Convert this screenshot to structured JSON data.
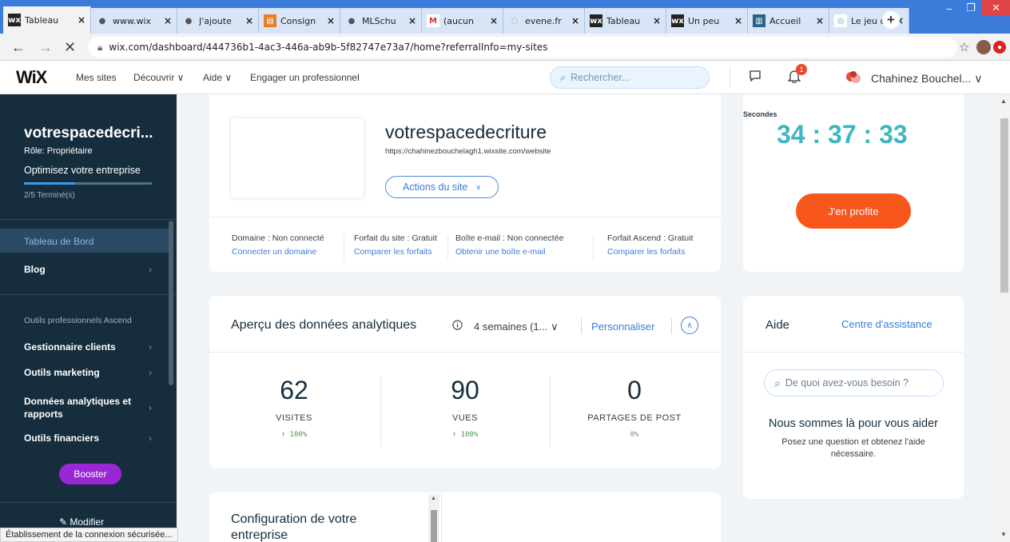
{
  "browser": {
    "tabs": [
      {
        "icon": "wix-icon",
        "title": "Tableau"
      },
      {
        "icon": "globe-icon",
        "title": "www.wix"
      },
      {
        "icon": "globe-icon",
        "title": "J'ajoute"
      },
      {
        "icon": "document-icon",
        "title": "Consign"
      },
      {
        "icon": "globe-icon",
        "title": "MLSchu"
      },
      {
        "icon": "gmail-icon",
        "title": "(aucun"
      },
      {
        "icon": "loading-icon",
        "title": "evene.fr"
      },
      {
        "icon": "wix-icon",
        "title": "Tableau"
      },
      {
        "icon": "wix-icon",
        "title": "Un peu"
      },
      {
        "icon": "book-icon",
        "title": "Accueil"
      },
      {
        "icon": "game-icon",
        "title": "Le jeu d"
      }
    ],
    "new_tab": "+",
    "window_controls": {
      "minimize": "–",
      "maximize": "❐",
      "close": "✕"
    },
    "url": "wix.com/dashboard/444736b1-4ac3-446a-ab9b-5f82747e73a7/home?referralInfo=my-sites",
    "status": "Établissement de la connexion sécurisée..."
  },
  "header": {
    "logo": "WiX",
    "nav": [
      "Mes sites",
      "Découvrir ∨",
      "Aide ∨",
      "Engager un professionnel"
    ],
    "search_placeholder": "Rechercher...",
    "notifications": "1",
    "user": "Chahinez Bouchel... ∨"
  },
  "sidebar": {
    "site_name": "votrespacedecri...",
    "role": "Rôle: Propriétaire",
    "optimize": "Optimisez votre entreprise",
    "progress": 0.4,
    "progress_text": "2/5 Terminé(s)",
    "items": [
      {
        "label": "Tableau de Bord"
      },
      {
        "label": "Blog",
        "chevron": "›"
      }
    ],
    "section_title": "Outils professionnels Ascend",
    "tools": [
      {
        "label": "Gestionnaire clients",
        "chevron": "›"
      },
      {
        "label": "Outils marketing",
        "chevron": "›"
      },
      {
        "label": "Données analytiques et rapports",
        "chevron": "›"
      },
      {
        "label": "Outils financiers",
        "chevron": "›"
      }
    ],
    "booster": "Booster",
    "edit": "Modifier"
  },
  "site": {
    "name": "votrespacedecriture",
    "url": "https://chahinezbouchelagh1.wixsite.com/website",
    "actions": "Actions du site",
    "info": [
      {
        "label": "Domaine : Non connecté",
        "link": "Connecter un domaine"
      },
      {
        "label": "Forfait du site : Gratuit",
        "link": "Comparer les forfaits"
      },
      {
        "label": "Boîte e-mail : Non connectée",
        "link": "Obtenir une boîte e-mail"
      },
      {
        "label": "Forfait Ascend : Gratuit",
        "link": "Comparer les forfaits"
      }
    ]
  },
  "promo": {
    "timer_label": "Secondes",
    "timer": "34 : 37 : 33",
    "button": "J'en profite"
  },
  "analytics": {
    "title": "Aperçu des données analytiques",
    "period": "4 semaines (1... ∨",
    "customize": "Personnaliser",
    "stats": [
      {
        "value": "62",
        "label": "VISITES",
        "change": "↑ 100%"
      },
      {
        "value": "90",
        "label": "VUES",
        "change": "↑ 100%"
      },
      {
        "value": "0",
        "label": "PARTAGES DE POST",
        "change": "0%"
      }
    ]
  },
  "help": {
    "title": "Aide",
    "link": "Centre d'assistance",
    "search_placeholder": "De quoi avez-vous besoin ?",
    "heading": "Nous sommes là pour vous aider",
    "text": "Posez une question et obtenez l'aide nécessaire."
  },
  "config": {
    "title": "Configuration de votre entreprise"
  },
  "colors": {
    "accent": "#3b7bd9",
    "sidebar": "#162d3d",
    "booster": "#9a27d5",
    "cta": "#f7561c",
    "timer": "#3fb7c0"
  }
}
